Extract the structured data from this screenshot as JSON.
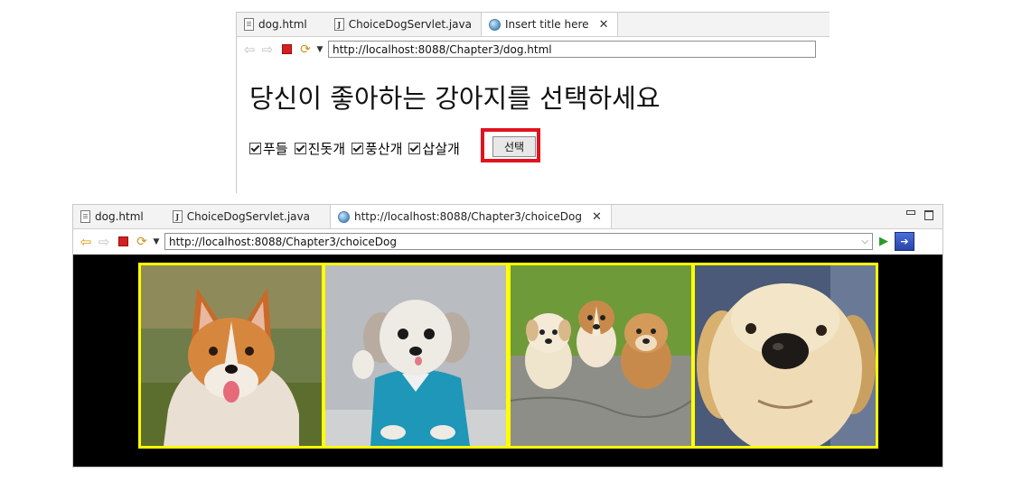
{
  "top_window": {
    "tabs": [
      {
        "label": "dog.html",
        "icon": "html-file-icon"
      },
      {
        "label": "ChoiceDogServlet.java",
        "icon": "java-file-icon"
      },
      {
        "label": "Insert title here",
        "icon": "globe-icon",
        "active": true
      }
    ],
    "url": "http://localhost:8088/Chapter3/dog.html",
    "heading": "당신이 좋아하는 강아지를 선택하세요",
    "checkboxes": [
      "푸들",
      "진돗개",
      "풍산개",
      "삽살개"
    ],
    "submit_label": "선택"
  },
  "bottom_window": {
    "tabs": [
      {
        "label": "dog.html",
        "icon": "html-file-icon"
      },
      {
        "label": "ChoiceDogServlet.java",
        "icon": "java-file-icon"
      },
      {
        "label": "http://localhost:8088/Chapter3/choiceDog",
        "icon": "globe-icon",
        "active": true
      }
    ],
    "url": "http://localhost:8088/Chapter3/choiceDog",
    "images": [
      "corgi-photo",
      "white-dog-blue-shirt-photo",
      "three-puppies-photo",
      "puppy-closeup-photo"
    ],
    "colors": {
      "image_border": "#ffff00",
      "background": "#000000",
      "highlight": "#e0141e"
    }
  }
}
